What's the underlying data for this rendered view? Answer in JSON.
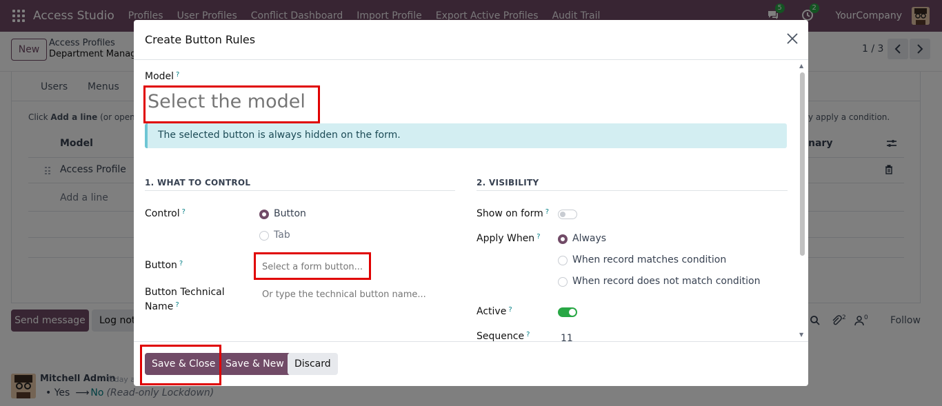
{
  "navbar": {
    "app_title": "Access Studio",
    "menus": [
      "Profiles",
      "User Profiles",
      "Conflict Dashboard",
      "Import Profile",
      "Export Active Profiles",
      "Audit Trail"
    ],
    "messages_count": "5",
    "activities_count": "2",
    "company": "YourCompany",
    "accent": "#714b67"
  },
  "control_panel": {
    "new_label": "New",
    "breadcrumb_parent": "Access Profiles",
    "breadcrumb_current": "Department Manag",
    "pager": "1 / 3"
  },
  "sheet": {
    "tabs": [
      "Users",
      "Menus"
    ],
    "hint_start_bold": "Add a line",
    "hint_start_pre": "Click ",
    "hint_start_post": " (or open a",
    "hint_end": "y apply a condition.",
    "col_model": "Model",
    "col_summary": "nary",
    "row_model": "Access Profile",
    "add_line": "Add a line"
  },
  "chatter": {
    "send_message": "Send message",
    "log_note": "Log not",
    "follow": "Follow",
    "attachments_count": "2",
    "followers_count": "0",
    "author": "Mitchell Admin",
    "time": "Today at",
    "old_value": "Yes",
    "new_value": "No",
    "note": "(Read-only Lockdown)"
  },
  "modal": {
    "title": "Create Button Rules",
    "model_label": "Model",
    "model_placeholder": "Select the model...",
    "alert": "The selected button is always hidden on the form.",
    "section1": "1. WHAT TO CONTROL",
    "section2": "2. VISIBILITY",
    "control_label": "Control",
    "control_options": [
      "Button",
      "Tab"
    ],
    "control_selected": "Button",
    "button_label": "Button",
    "button_placeholder": "Select a form button...",
    "button_tech_label_1": "Button Technical",
    "button_tech_label_2": "Name",
    "button_tech_placeholder": "Or type the technical button name...",
    "show_on_form_label": "Show on form",
    "show_on_form": false,
    "apply_when_label": "Apply When",
    "apply_when_options": [
      "Always",
      "When record matches condition",
      "When record does not match condition"
    ],
    "apply_when_selected": "Always",
    "active_label": "Active",
    "active": true,
    "sequence_label": "Sequence",
    "sequence_value": "11",
    "help_mark": "?"
  },
  "footer": {
    "save_close": "Save & Close",
    "save_new": "Save & New",
    "discard": "Discard"
  }
}
